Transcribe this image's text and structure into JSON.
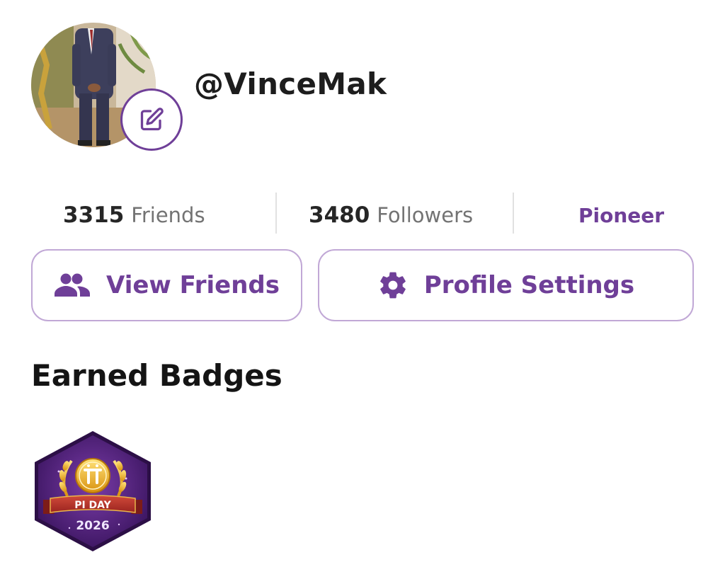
{
  "profile": {
    "username": "@VinceMak",
    "avatar_icon": "profile-photo",
    "edit_icon": "edit-icon"
  },
  "stats": {
    "friends_count": "3315",
    "friends_label": "Friends",
    "followers_count": "3480",
    "followers_label": "Followers",
    "role": "Pioneer"
  },
  "actions": {
    "view_friends_label": "View Friends",
    "view_friends_icon": "people-icon",
    "profile_settings_label": "Profile Settings",
    "profile_settings_icon": "gear-icon"
  },
  "badges": {
    "title": "Earned Badges",
    "items": [
      {
        "ribbon_text": "PI DAY",
        "year": "2026",
        "icon": "pi-day-badge"
      }
    ]
  },
  "colors": {
    "accent": "#6f3f98",
    "button_border": "#c1a8d6",
    "muted_text": "#737373"
  }
}
